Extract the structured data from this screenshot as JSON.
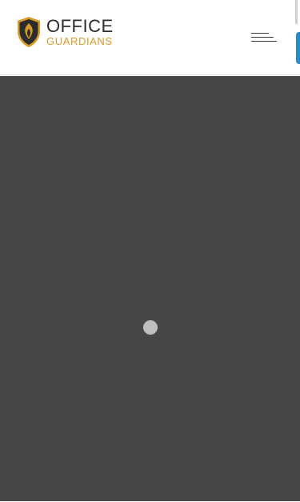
{
  "header": {
    "logo": {
      "line1": "OFFICE",
      "line2": "GUARDIANS",
      "icon": "shield-flame-icon"
    },
    "menu_button": {
      "icon": "hamburger-menu-icon"
    }
  },
  "main": {
    "loading_indicator": {
      "icon": "loading-dot-icon"
    }
  },
  "colors": {
    "header_bg": "#ffffff",
    "content_bg": "#474747",
    "brand_gold": "#d79a2a",
    "brand_dark": "#2c2c2c",
    "accent_blue": "#2a8bc9",
    "loader": "#bfbfbf"
  }
}
